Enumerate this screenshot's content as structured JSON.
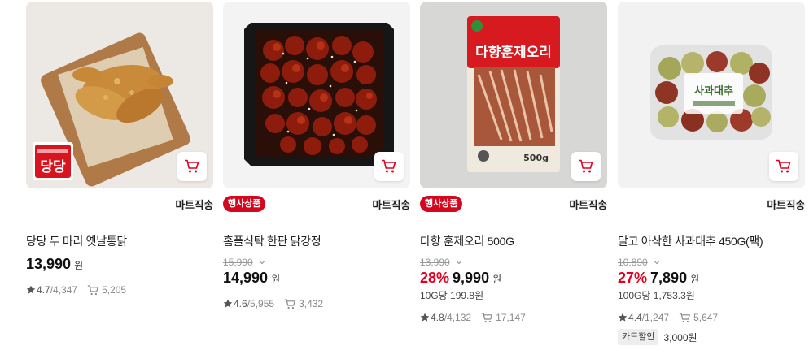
{
  "products": [
    {
      "title": "당당 두 마리 옛날통닭",
      "delivery": "마트직송",
      "event_badge": "",
      "original_price": "",
      "discount": "",
      "price": "13,990",
      "won": "원",
      "unit_price": "",
      "rating": "4.7",
      "reviews": "/4,347",
      "cart_count": "5,205",
      "card_badge": "",
      "card_discount": "",
      "brand_logo_text": "당당"
    },
    {
      "title": "홈플식탁 한판 닭강정",
      "delivery": "마트직송",
      "event_badge": "행사상품",
      "original_price": "15,990",
      "discount": "",
      "price": "14,990",
      "won": "원",
      "unit_price": "",
      "rating": "4.6",
      "reviews": "/5,955",
      "cart_count": "3,432",
      "card_badge": "",
      "card_discount": ""
    },
    {
      "title": "다향 훈제오리 500G",
      "delivery": "마트직송",
      "event_badge": "행사상품",
      "original_price": "13,990",
      "discount": "28%",
      "price": "9,990",
      "won": "원",
      "unit_price": "10G당 199.8원",
      "rating": "4.8",
      "reviews": "/4,132",
      "cart_count": "17,147",
      "card_badge": "",
      "card_discount": "",
      "package_text": "다향훈제오리",
      "package_weight": "500g"
    },
    {
      "title": "달고 아삭한 사과대추 450G(팩)",
      "delivery": "마트직송",
      "event_badge": "",
      "original_price": "10,890",
      "discount": "27%",
      "price": "7,890",
      "won": "원",
      "unit_price": "100G당 1,753.3원",
      "rating": "4.4",
      "reviews": "/1,247",
      "cart_count": "5,647",
      "card_badge": "카드할인",
      "card_discount": "3,000원",
      "package_text": "사과대추"
    }
  ],
  "colors": {
    "accent_red": "#e1001f",
    "badge_red": "#d3081f",
    "star": "#555555"
  },
  "icons": [
    "cart-icon",
    "star-icon",
    "chevron-down-icon"
  ]
}
